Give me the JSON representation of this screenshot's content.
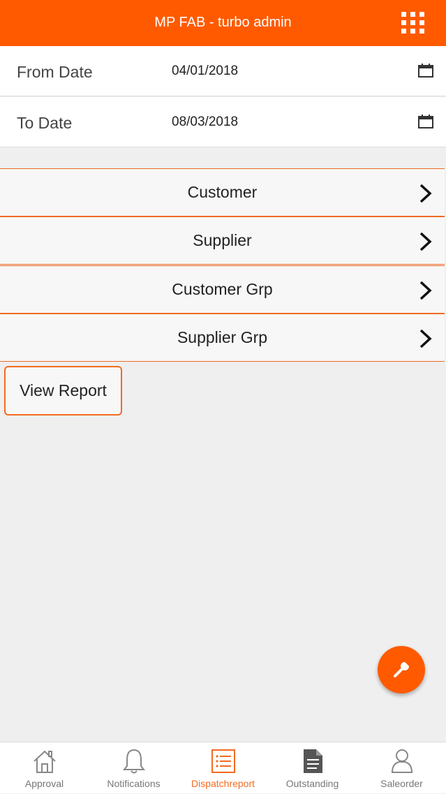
{
  "header": {
    "title": "MP FAB - turbo admin",
    "menu_icon": "grid-menu-icon"
  },
  "filters": {
    "from_date": {
      "label": "From Date",
      "value": "04/01/2018",
      "icon": "calendar-icon"
    },
    "to_date": {
      "label": "To Date",
      "value": "08/03/2018",
      "icon": "calendar-icon"
    }
  },
  "nav_items": [
    {
      "label": "Customer"
    },
    {
      "label": "Supplier"
    },
    {
      "label": "Customer Grp"
    },
    {
      "label": "Supplier Grp"
    }
  ],
  "view_report_label": "View Report",
  "fab": {
    "icon": "wrench-icon"
  },
  "bottom_nav": {
    "tabs": [
      {
        "label": "Approval",
        "icon": "home-icon"
      },
      {
        "label": "Notifications",
        "icon": "bell-icon"
      },
      {
        "label": "Dispatchreport",
        "icon": "list-icon"
      },
      {
        "label": "Outstanding",
        "icon": "document-icon"
      },
      {
        "label": "Saleorder",
        "icon": "user-icon"
      }
    ],
    "active_tab": "Dispatchreport"
  },
  "colors": {
    "accent": "#ff5a00",
    "border_accent": "#f06a22",
    "background": "#efefef"
  }
}
